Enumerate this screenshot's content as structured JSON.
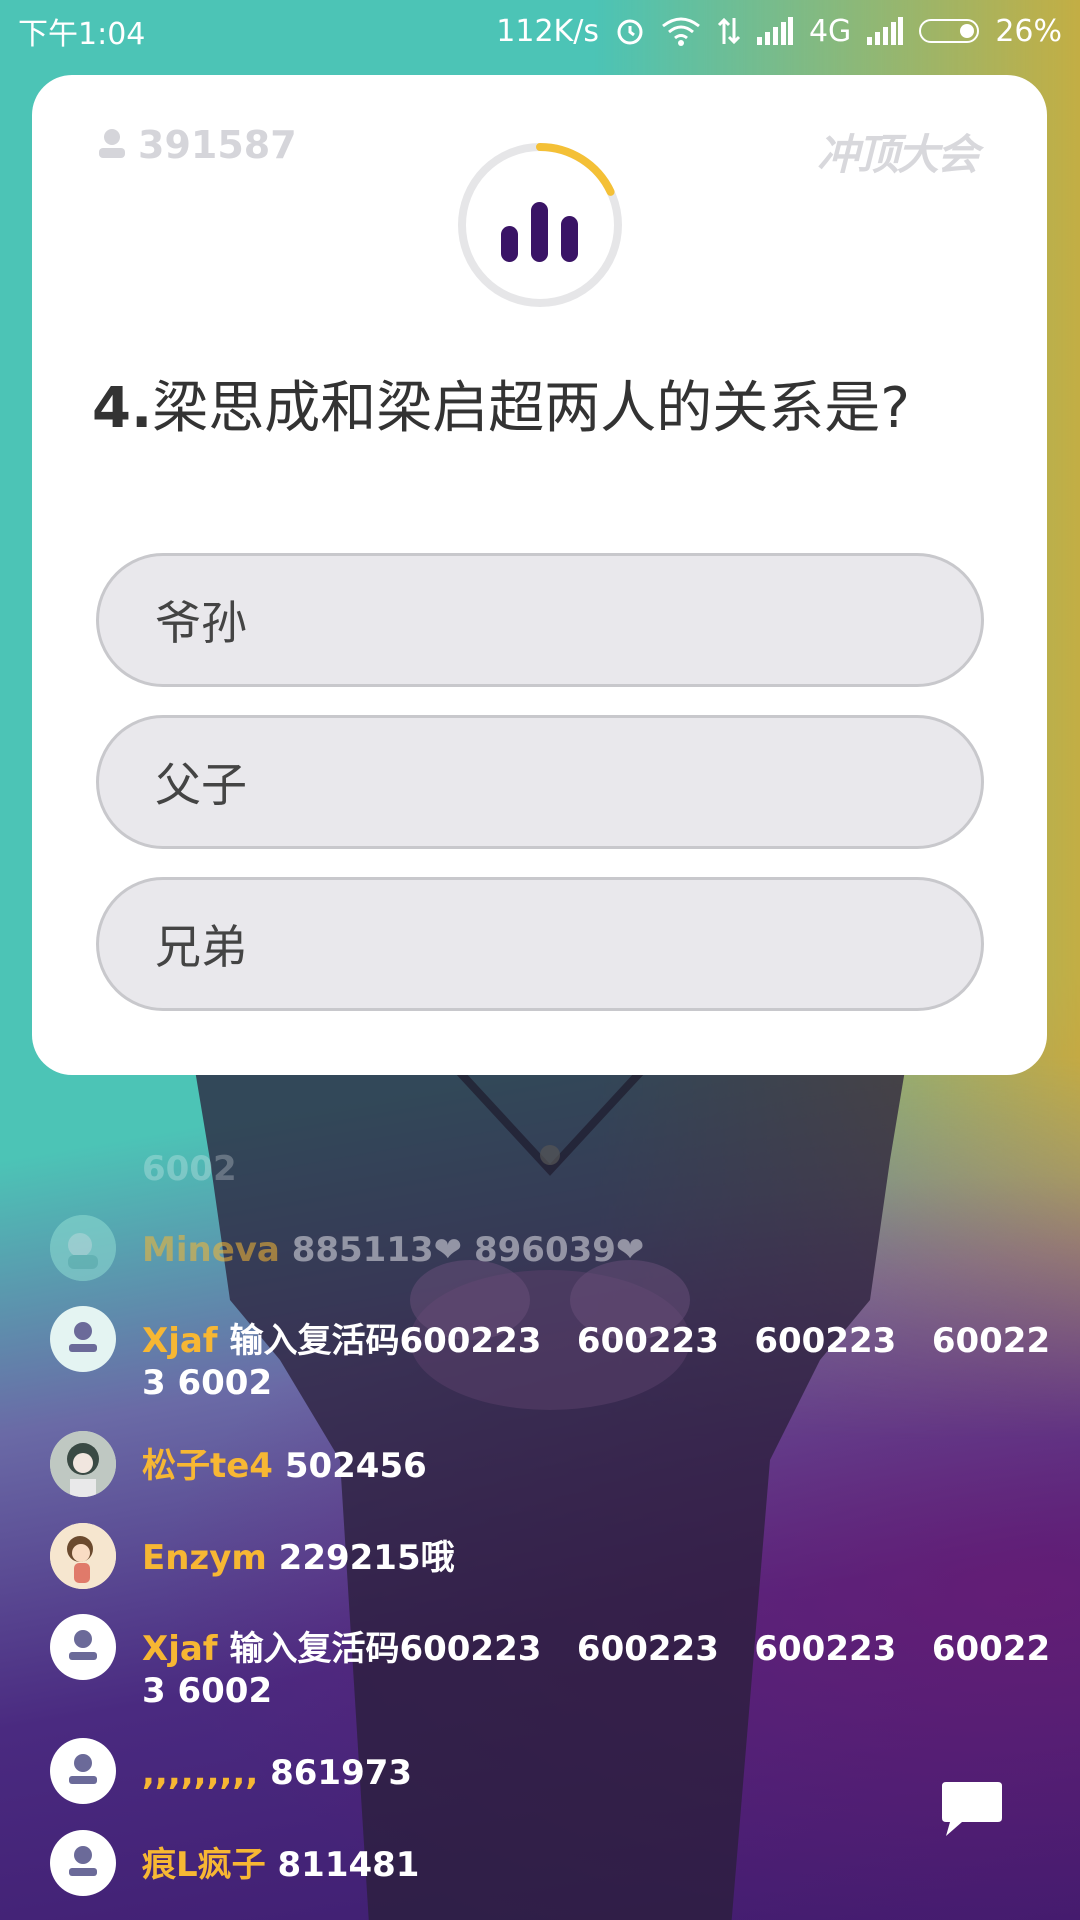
{
  "status_bar": {
    "time": "下午1:04",
    "net_speed": "112K/s",
    "network": "4G",
    "battery": "26%"
  },
  "card": {
    "viewer_count": "391587",
    "brand": "冲顶大会",
    "question_number": "4.",
    "question_text": "梁思成和梁启超两人的关系是?",
    "timer_progress": 0.18,
    "options": [
      "爷孙",
      "父子",
      "兄弟"
    ]
  },
  "comments": [
    {
      "user": "",
      "text": "6002",
      "avatar": "blank",
      "faded": true
    },
    {
      "user": "Mineva",
      "text": "885113❤ 896039❤",
      "avatar": "photo-teal",
      "faded": true
    },
    {
      "user": "Xjaf",
      "text": "输入复活码600223   600223   600223   600223 6002",
      "avatar": "default",
      "faded": false
    },
    {
      "user": "松子te4",
      "text": "502456",
      "avatar": "photo-girl",
      "faded": false
    },
    {
      "user": "Enzym",
      "text": "229215哦",
      "avatar": "photo-anime",
      "faded": false
    },
    {
      "user": "Xjaf",
      "text": "输入复活码600223   600223   600223   600223 6002",
      "avatar": "default",
      "faded": false
    },
    {
      "user": ",,,,,,,,,",
      "text": "861973",
      "avatar": "default",
      "faded": false
    },
    {
      "user": "痕L疯子",
      "text": "811481",
      "avatar": "default",
      "faded": false
    }
  ],
  "colors": {
    "accent_timer": "#f4c036",
    "icon_purple": "#3a1466",
    "username": "#f7b733"
  }
}
